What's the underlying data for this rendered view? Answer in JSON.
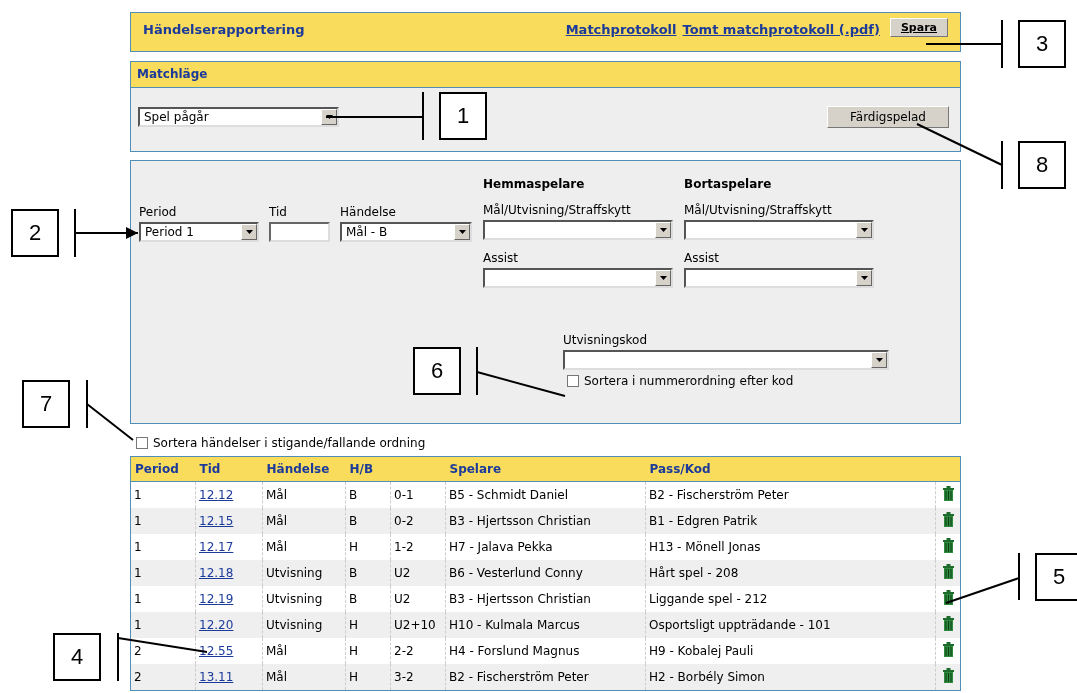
{
  "header": {
    "title": "Händelserapportering",
    "links": [
      "Matchprotokoll",
      "Tomt matchprotokoll (.pdf)"
    ],
    "save_button": "Spara"
  },
  "match_state": {
    "title": "Matchläge",
    "status_select": "Spel pågår",
    "finish_button": "Färdigspelad"
  },
  "event_form": {
    "period_label": "Period",
    "period_select": "Period 1",
    "time_label": "Tid",
    "event_label": "Händelse",
    "event_select": "Mål - B",
    "home": {
      "heading": "Hemmaspelare",
      "player_label": "Mål/Utvisning/Straffskytt",
      "assist_label": "Assist"
    },
    "away": {
      "heading": "Bortaspelare",
      "player_label": "Mål/Utvisning/Straffskytt",
      "assist_label": "Assist"
    },
    "penalty_code_label": "Utvisningskod",
    "sort_by_code": {
      "label": "Sortera i nummerordning efter kod",
      "checked": false
    }
  },
  "sort_events": {
    "label": "Sortera händelser i stigande/fallande ordning",
    "checked": false
  },
  "table": {
    "columns": {
      "period": "Period",
      "time": "Tid",
      "event": "Händelse",
      "side": "H/B",
      "player": "Spelare",
      "pass_code": "Pass/Kod"
    },
    "rows": [
      {
        "period": "1",
        "time": "12.12",
        "event": "Mål",
        "side": "B",
        "column_5": "0-1",
        "player": "B5 - Schmidt Daniel",
        "pass_code": "B2 - Fischerström Peter"
      },
      {
        "period": "1",
        "time": "12.15",
        "event": "Mål",
        "side": "B",
        "column_5": "0-2",
        "player": "B3 - Hjertsson Christian",
        "pass_code": "B1 - Edgren Patrik"
      },
      {
        "period": "1",
        "time": "12.17",
        "event": "Mål",
        "side": "H",
        "column_5": "1-2",
        "player": "H7 - Jalava Pekka",
        "pass_code": "H13 - Mönell Jonas"
      },
      {
        "period": "1",
        "time": "12.18",
        "event": "Utvisning",
        "side": "B",
        "column_5": "U2",
        "player": "B6 - Vesterlund Conny",
        "pass_code": "Hårt spel - 208"
      },
      {
        "period": "1",
        "time": "12.19",
        "event": "Utvisning",
        "side": "B",
        "column_5": "U2",
        "player": "B3 - Hjertsson Christian",
        "pass_code": "Liggande spel - 212"
      },
      {
        "period": "1",
        "time": "12.20",
        "event": "Utvisning",
        "side": "H",
        "column_5": "U2+10",
        "player": "H10 - Kulmala Marcus",
        "pass_code": "Osportsligt uppträdande - 101"
      },
      {
        "period": "2",
        "time": "12.55",
        "event": "Mål",
        "side": "H",
        "column_5": "2-2",
        "player": "H4 - Forslund Magnus",
        "pass_code": "H9 - Kobalej Pauli"
      },
      {
        "period": "2",
        "time": "13.11",
        "event": "Mål",
        "side": "H",
        "column_5": "3-2",
        "player": "B2 - Fischerström Peter",
        "pass_code": "H2 - Borbély Simon"
      }
    ]
  },
  "callouts": [
    {
      "label": "1"
    },
    {
      "label": "2"
    },
    {
      "label": "3"
    },
    {
      "label": "4"
    },
    {
      "label": "5"
    },
    {
      "label": "6"
    },
    {
      "label": "7"
    },
    {
      "label": "8"
    }
  ]
}
